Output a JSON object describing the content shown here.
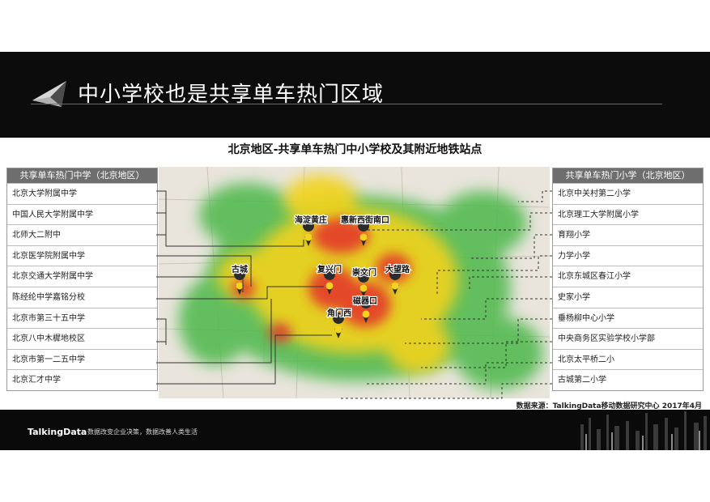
{
  "header": {
    "title": "中小学校也是共享单车热门区域"
  },
  "subtitle": "北京地区-共享单车热门中小学校及其附近地铁站点",
  "left_list": {
    "heading": "共享单车热门中学（北京地区）",
    "items": [
      "北京大学附属中学",
      "中国人民大学附属中学",
      "北师大二附中",
      "北京医学院附属中学",
      "北京交通大学附属中学",
      "陈经纶中学嘉铭分校",
      "北京市第三十五中学",
      "北京八中木樨地校区",
      "北京市第一二五中学",
      "北京汇才中学"
    ]
  },
  "right_list": {
    "heading": "共享单车热门小学（北京地区）",
    "items": [
      "北京中关村第二小学",
      "北京理工大学附属小学",
      "育翔小学",
      "力学小学",
      "北京东城区春江小学",
      "史家小学",
      "垂杨柳中心小学",
      "中央商务区实验学校小学部",
      "北京太平桥二小",
      "古城第二小学"
    ]
  },
  "map": {
    "stations": [
      "海淀黄庄",
      "惠新西街南口",
      "古城",
      "复兴门",
      "崇文门",
      "大望路",
      "磁器口",
      "角门西"
    ]
  },
  "source": "数据来源：TalkingData移动数据研究中心 2017年4月",
  "footer": {
    "brand": "TalkingData",
    "slogan": "数据改变企业决策，数据改善人类生活"
  },
  "colors": {
    "header_bg": "#0c0c0c",
    "list_head": "#6e6e6e",
    "heat_hot": "#e0302a",
    "heat_mid": "#f4d21f",
    "heat_low": "#49b649"
  }
}
